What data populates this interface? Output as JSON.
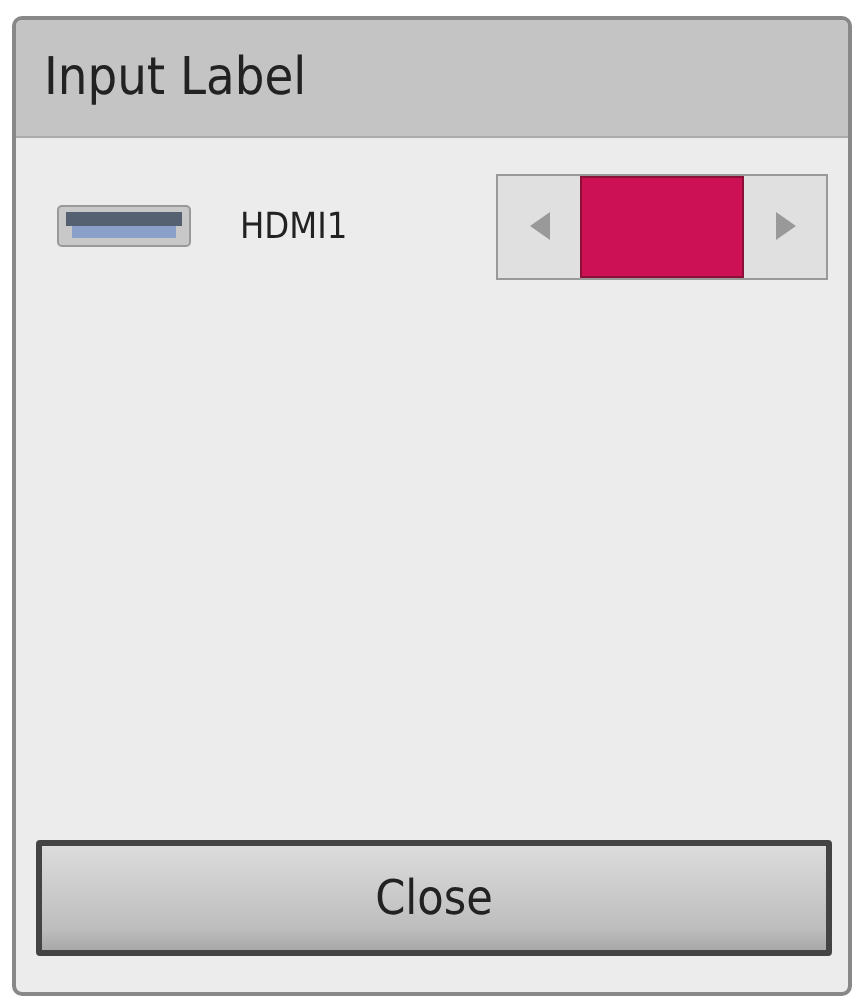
{
  "window": {
    "title": "Input Label"
  },
  "inputs": [
    {
      "name": "HDMI1",
      "color": "#cc1255"
    }
  ],
  "buttons": [
    "Close"
  ]
}
